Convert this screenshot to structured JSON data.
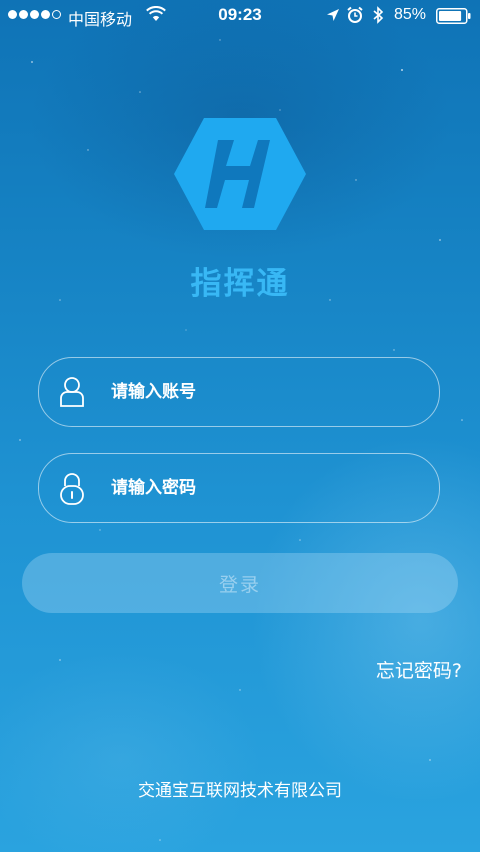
{
  "status_bar": {
    "carrier": "中国移动",
    "time": "09:23",
    "battery": "85%",
    "battery_level": 0.85,
    "signal_strength": 4,
    "icons": [
      "wifi-icon",
      "location-icon",
      "alarm-icon",
      "bluetooth-icon",
      "battery-icon"
    ]
  },
  "app": {
    "title": "指挥通",
    "logo_color": "#1fa9f0",
    "title_color": "#38b8f5"
  },
  "login": {
    "account_placeholder": "请输入账号",
    "account_icon": "user-icon",
    "password_placeholder": "请输入密码",
    "password_icon": "lock-icon",
    "submit_label": "登录",
    "forgot_label": "忘记密码?"
  },
  "footer": {
    "company": "交通宝互联网技术有限公司"
  }
}
